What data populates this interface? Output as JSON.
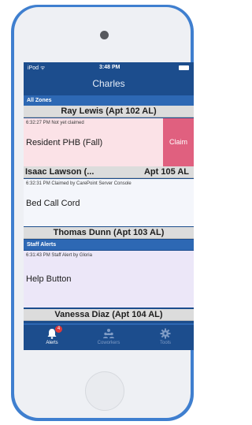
{
  "status_bar": {
    "carrier": "iPod ᯤ",
    "time": "3:48 PM"
  },
  "nav": {
    "title": "Charles"
  },
  "zones": [
    {
      "header": "All Zones",
      "residents": [
        {
          "name": "Ray  Lewis (Apt 102 AL)",
          "alert": {
            "meta": "6:32:27 PM  Not yet claimed",
            "title": "Resident PHB (Fall)",
            "claim_label": "Claim",
            "card_color": "#fbe2e7"
          }
        },
        {
          "name": "Isaac Lawson (...",
          "apt": "Apt 105 AL",
          "alert": {
            "meta": "6:32:31 PM  Claimed by CarePoint Server Console",
            "title": "Bed Call Cord",
            "card_color": "#f4f6fb"
          }
        },
        {
          "name": "Thomas Dunn (Apt 103 AL)"
        }
      ]
    },
    {
      "header": "Staff Alerts",
      "alert": {
        "meta": "6:31:43 PM  Staff Alert by Gloria",
        "title": "Help Button",
        "card_color": "#ece7f8"
      },
      "residents": [
        {
          "name": "Vanessa Diaz (Apt 104 AL)"
        }
      ]
    }
  ],
  "tabs": [
    {
      "label": "Alerts",
      "icon": "bell-icon",
      "badge": "4",
      "active": true
    },
    {
      "label": "Coworkers",
      "icon": "people-icon",
      "active": false
    },
    {
      "label": "Tools",
      "icon": "gear-icon",
      "active": false
    }
  ],
  "colors": {
    "accent": "#2d68b4",
    "nav_background": "#1c4d8d",
    "claim": "#e0607f",
    "badge": "#e03a3a",
    "device_frame": "#3f7fcf"
  }
}
